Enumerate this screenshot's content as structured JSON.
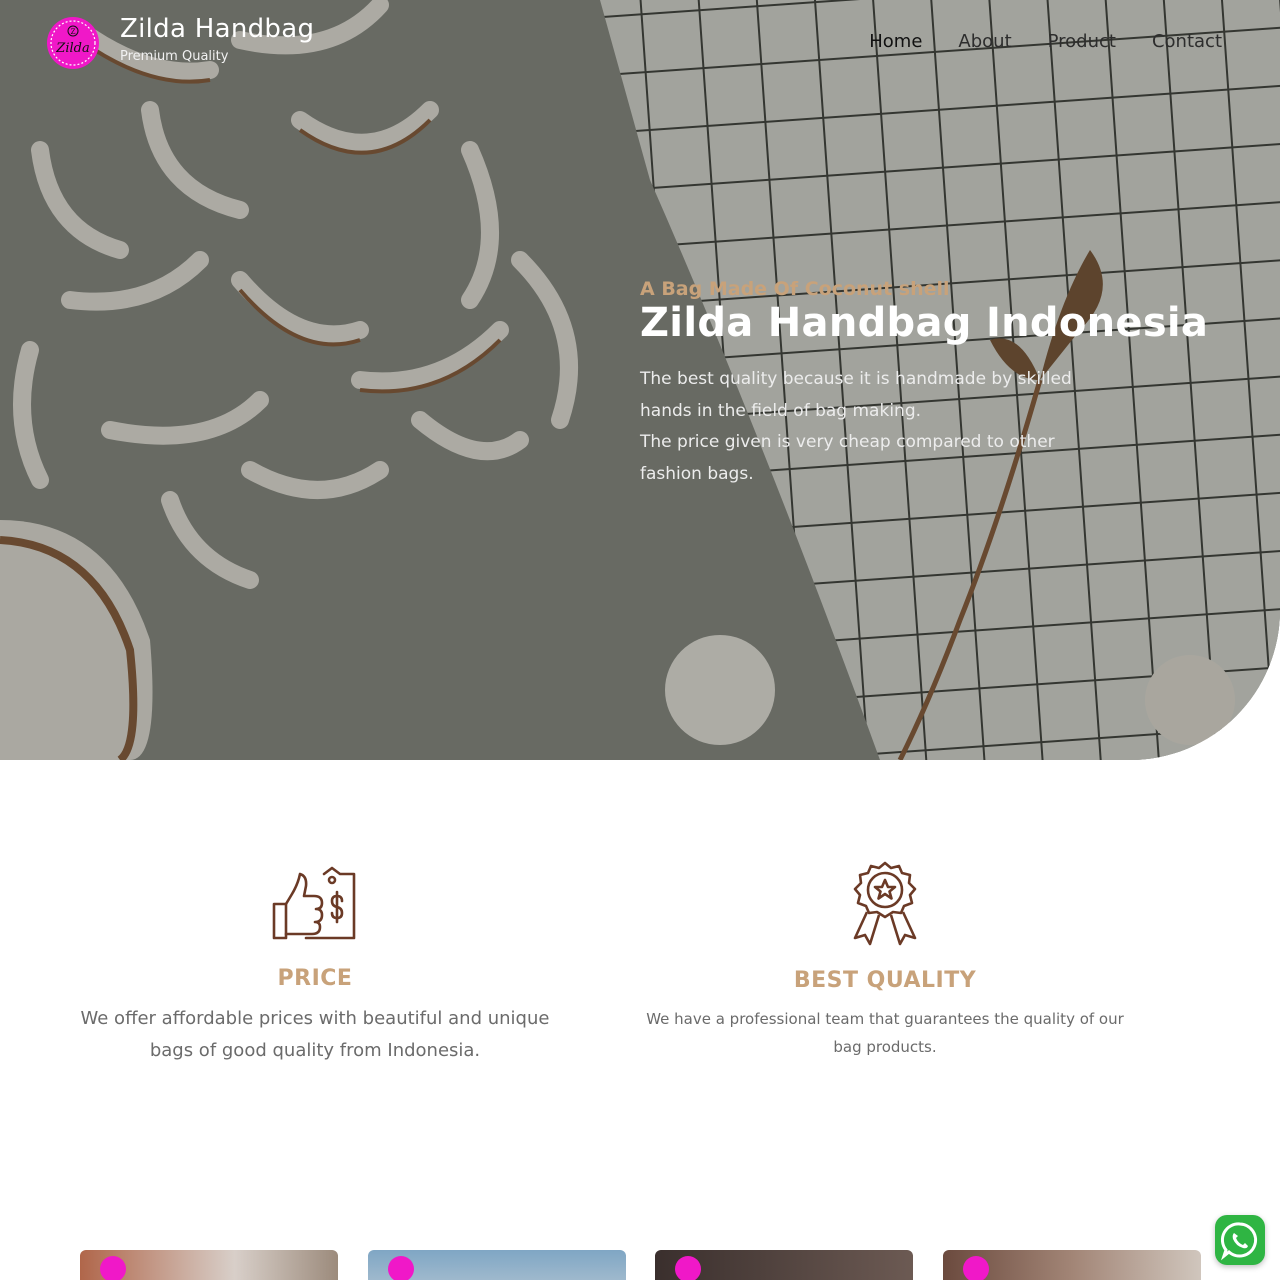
{
  "header": {
    "brand_title": "Zilda Handbag",
    "brand_subtitle": "Premium Quality",
    "logo_text": "Zilda",
    "nav": [
      {
        "label": "Home",
        "active": true
      },
      {
        "label": "About",
        "active": false
      },
      {
        "label": "Product",
        "active": false
      },
      {
        "label": "Contact",
        "active": false
      }
    ]
  },
  "hero": {
    "kicker": "A Bag Made Of Coconut shell",
    "title": "Zilda Handbag Indonesia",
    "description_line1": "The best quality because it is handmade by skilled hands in the field of bag making.",
    "description_line2": "The price given is very cheap compared to other fashion bags."
  },
  "features": [
    {
      "icon": "thumbs-up-price-tag-icon",
      "title": "PRICE",
      "text": "We offer affordable prices with beautiful and unique bags of good quality from Indonesia."
    },
    {
      "icon": "award-badge-icon",
      "title": "BEST QUALITY",
      "text": "We have a professional team that guarantees the quality of our bag products."
    }
  ],
  "colors": {
    "accent": "#c8a27a",
    "icon_brown": "#6b3a26",
    "logo_pink": "#f018c8",
    "whatsapp": "#2fb543"
  }
}
